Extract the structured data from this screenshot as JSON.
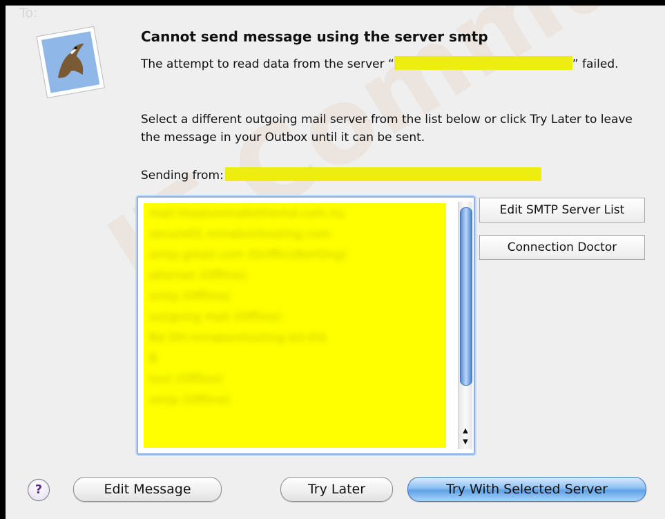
{
  "dialog": {
    "title": "Cannot send message using the server smtp",
    "message_part1": "The attempt to read data from the server “",
    "message_part2": "” failed.",
    "instructions": "Select a different outgoing mail server from the list below or click Try Later to leave the message in your Outbox until it can be sent.",
    "sending_from_label": "Sending from:"
  },
  "background_text": "To:        ",
  "watermark": "IT Communicatio",
  "server_list": {
    "items": [
      "mail.thealummakethemd.com.nu",
      "secure01.nnnabonhosting.com",
      "smtp.gmail.com (Griffin1Bertling)",
      "alternet (Offline)",
      "smtp (Offline)",
      "outgoing mail (Offline)",
      "Bd DH.nnnabonhosting.bd.thb",
      "B",
      "test (Offline)",
      "smtp (Offline)"
    ]
  },
  "buttons": {
    "edit_smtp": "Edit SMTP Server List",
    "connection_doctor": "Connection Doctor",
    "help": "?",
    "edit_message": "Edit Message",
    "try_later": "Try Later",
    "try_selected": "Try With Selected Server"
  },
  "colors": {
    "highlight": "#eded10",
    "list_bg": "#ffff00",
    "default_button": "#6aa9ea",
    "focus_ring": "#8db2e3"
  }
}
